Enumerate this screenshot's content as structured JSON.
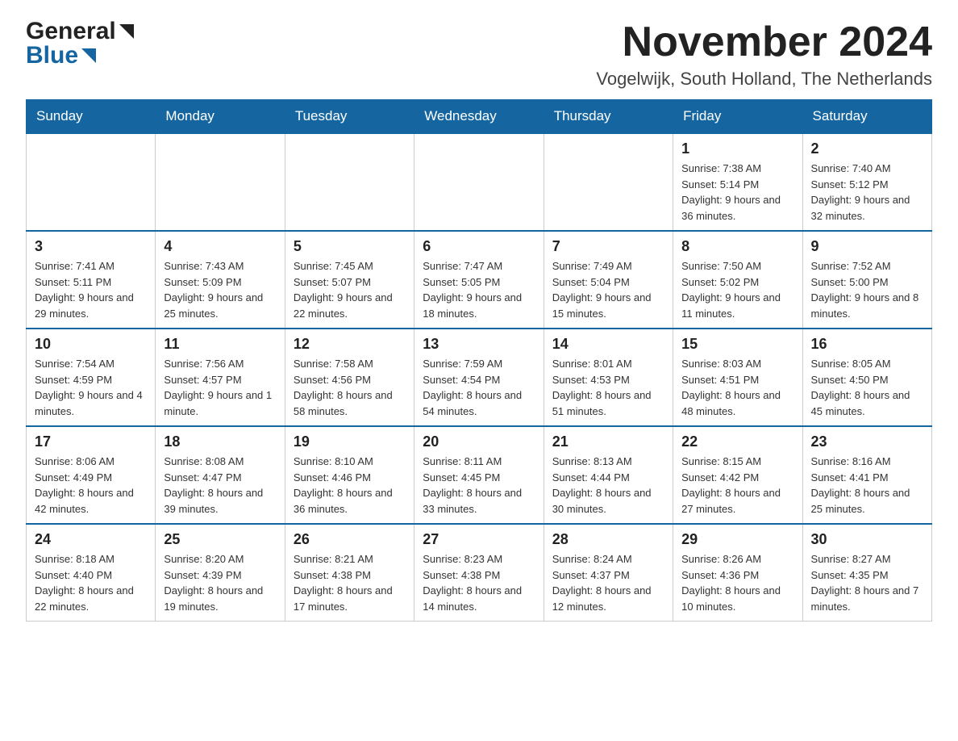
{
  "logo": {
    "line1": "General",
    "line2": "Blue"
  },
  "title": "November 2024",
  "subtitle": "Vogelwijk, South Holland, The Netherlands",
  "days_of_week": [
    "Sunday",
    "Monday",
    "Tuesday",
    "Wednesday",
    "Thursday",
    "Friday",
    "Saturday"
  ],
  "weeks": [
    [
      {
        "day": "",
        "info": ""
      },
      {
        "day": "",
        "info": ""
      },
      {
        "day": "",
        "info": ""
      },
      {
        "day": "",
        "info": ""
      },
      {
        "day": "",
        "info": ""
      },
      {
        "day": "1",
        "info": "Sunrise: 7:38 AM\nSunset: 5:14 PM\nDaylight: 9 hours and 36 minutes."
      },
      {
        "day": "2",
        "info": "Sunrise: 7:40 AM\nSunset: 5:12 PM\nDaylight: 9 hours and 32 minutes."
      }
    ],
    [
      {
        "day": "3",
        "info": "Sunrise: 7:41 AM\nSunset: 5:11 PM\nDaylight: 9 hours and 29 minutes."
      },
      {
        "day": "4",
        "info": "Sunrise: 7:43 AM\nSunset: 5:09 PM\nDaylight: 9 hours and 25 minutes."
      },
      {
        "day": "5",
        "info": "Sunrise: 7:45 AM\nSunset: 5:07 PM\nDaylight: 9 hours and 22 minutes."
      },
      {
        "day": "6",
        "info": "Sunrise: 7:47 AM\nSunset: 5:05 PM\nDaylight: 9 hours and 18 minutes."
      },
      {
        "day": "7",
        "info": "Sunrise: 7:49 AM\nSunset: 5:04 PM\nDaylight: 9 hours and 15 minutes."
      },
      {
        "day": "8",
        "info": "Sunrise: 7:50 AM\nSunset: 5:02 PM\nDaylight: 9 hours and 11 minutes."
      },
      {
        "day": "9",
        "info": "Sunrise: 7:52 AM\nSunset: 5:00 PM\nDaylight: 9 hours and 8 minutes."
      }
    ],
    [
      {
        "day": "10",
        "info": "Sunrise: 7:54 AM\nSunset: 4:59 PM\nDaylight: 9 hours and 4 minutes."
      },
      {
        "day": "11",
        "info": "Sunrise: 7:56 AM\nSunset: 4:57 PM\nDaylight: 9 hours and 1 minute."
      },
      {
        "day": "12",
        "info": "Sunrise: 7:58 AM\nSunset: 4:56 PM\nDaylight: 8 hours and 58 minutes."
      },
      {
        "day": "13",
        "info": "Sunrise: 7:59 AM\nSunset: 4:54 PM\nDaylight: 8 hours and 54 minutes."
      },
      {
        "day": "14",
        "info": "Sunrise: 8:01 AM\nSunset: 4:53 PM\nDaylight: 8 hours and 51 minutes."
      },
      {
        "day": "15",
        "info": "Sunrise: 8:03 AM\nSunset: 4:51 PM\nDaylight: 8 hours and 48 minutes."
      },
      {
        "day": "16",
        "info": "Sunrise: 8:05 AM\nSunset: 4:50 PM\nDaylight: 8 hours and 45 minutes."
      }
    ],
    [
      {
        "day": "17",
        "info": "Sunrise: 8:06 AM\nSunset: 4:49 PM\nDaylight: 8 hours and 42 minutes."
      },
      {
        "day": "18",
        "info": "Sunrise: 8:08 AM\nSunset: 4:47 PM\nDaylight: 8 hours and 39 minutes."
      },
      {
        "day": "19",
        "info": "Sunrise: 8:10 AM\nSunset: 4:46 PM\nDaylight: 8 hours and 36 minutes."
      },
      {
        "day": "20",
        "info": "Sunrise: 8:11 AM\nSunset: 4:45 PM\nDaylight: 8 hours and 33 minutes."
      },
      {
        "day": "21",
        "info": "Sunrise: 8:13 AM\nSunset: 4:44 PM\nDaylight: 8 hours and 30 minutes."
      },
      {
        "day": "22",
        "info": "Sunrise: 8:15 AM\nSunset: 4:42 PM\nDaylight: 8 hours and 27 minutes."
      },
      {
        "day": "23",
        "info": "Sunrise: 8:16 AM\nSunset: 4:41 PM\nDaylight: 8 hours and 25 minutes."
      }
    ],
    [
      {
        "day": "24",
        "info": "Sunrise: 8:18 AM\nSunset: 4:40 PM\nDaylight: 8 hours and 22 minutes."
      },
      {
        "day": "25",
        "info": "Sunrise: 8:20 AM\nSunset: 4:39 PM\nDaylight: 8 hours and 19 minutes."
      },
      {
        "day": "26",
        "info": "Sunrise: 8:21 AM\nSunset: 4:38 PM\nDaylight: 8 hours and 17 minutes."
      },
      {
        "day": "27",
        "info": "Sunrise: 8:23 AM\nSunset: 4:38 PM\nDaylight: 8 hours and 14 minutes."
      },
      {
        "day": "28",
        "info": "Sunrise: 8:24 AM\nSunset: 4:37 PM\nDaylight: 8 hours and 12 minutes."
      },
      {
        "day": "29",
        "info": "Sunrise: 8:26 AM\nSunset: 4:36 PM\nDaylight: 8 hours and 10 minutes."
      },
      {
        "day": "30",
        "info": "Sunrise: 8:27 AM\nSunset: 4:35 PM\nDaylight: 8 hours and 7 minutes."
      }
    ]
  ]
}
